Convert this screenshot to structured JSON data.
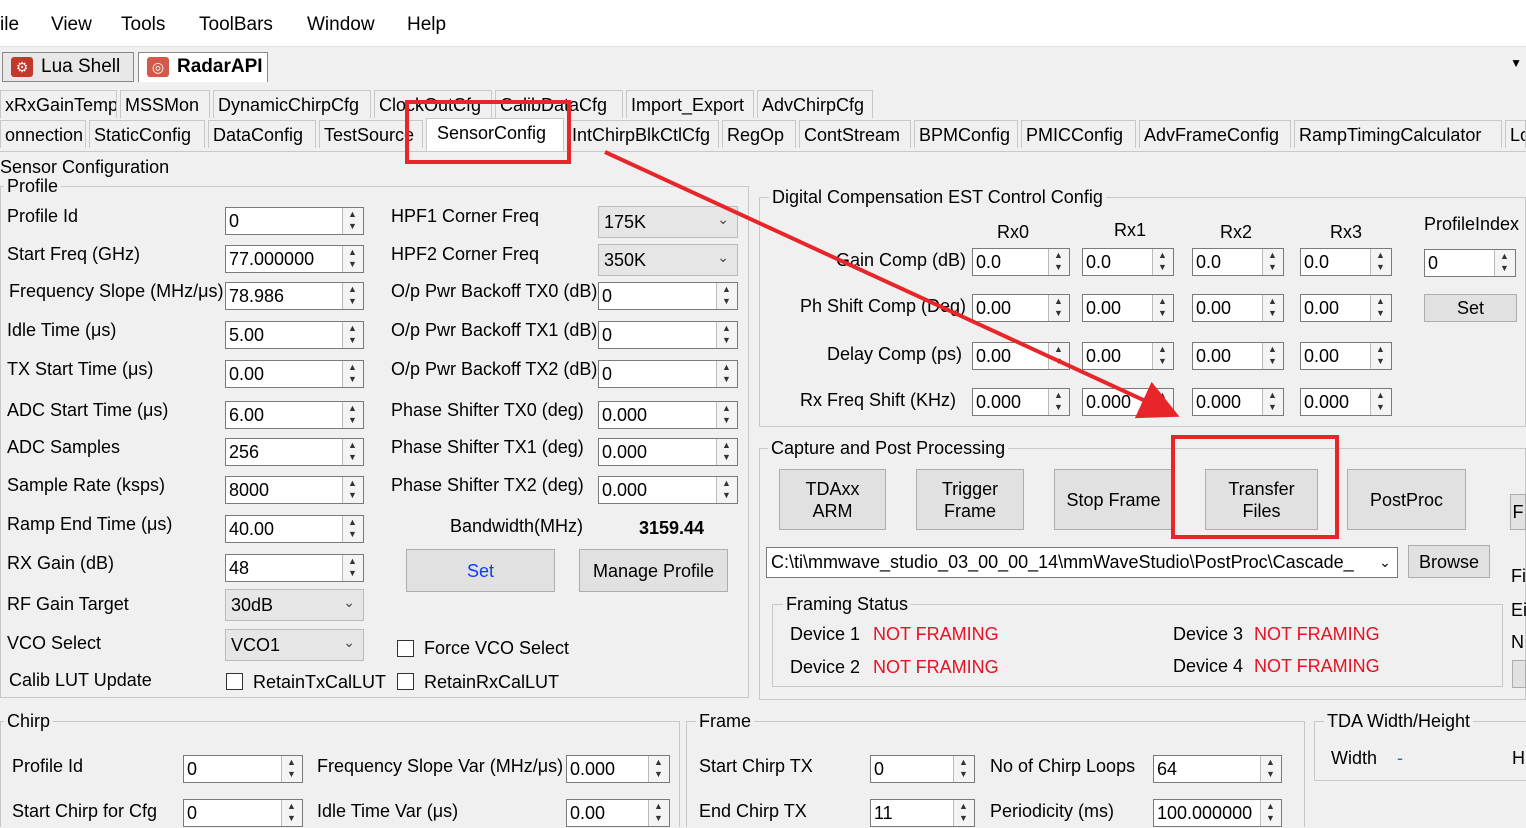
{
  "menu": [
    "ile",
    "View",
    "Tools",
    "ToolBars",
    "Window",
    "Help"
  ],
  "shell_tabs": [
    "Lua Shell",
    "RadarAPI"
  ],
  "tabs_row1": [
    "xRxGainTemp",
    "MSSMon",
    "DynamicChirpCfg",
    "ClockOutCfg",
    "CalibDataCfg",
    "Import_Export",
    "AdvChirpCfg"
  ],
  "tabs_row2": [
    "onnection",
    "StaticConfig",
    "DataConfig",
    "TestSource",
    "SensorConfig",
    "IntChirpBlkCtlCfg",
    "RegOp",
    "ContStream",
    "BPMConfig",
    "PMICConfig",
    "AdvFrameConfig",
    "RampTimingCalculator",
    "Lo"
  ],
  "sensor": {
    "title": "Sensor Configuration",
    "profile_title": "Profile",
    "profile": [
      {
        "label": "Profile Id",
        "value": "0"
      },
      {
        "label": "Start Freq (GHz)",
        "value": "77.000000"
      },
      {
        "label": "Frequency Slope (MHz/μs)",
        "value": "78.986"
      },
      {
        "label": "Idle Time (μs)",
        "value": "5.00"
      },
      {
        "label": "TX Start Time (μs)",
        "value": "0.00"
      },
      {
        "label": "ADC Start Time (μs)",
        "value": "6.00"
      },
      {
        "label": "ADC Samples",
        "value": "256"
      },
      {
        "label": "Sample Rate (ksps)",
        "value": "8000"
      },
      {
        "label": "Ramp End Time (μs)",
        "value": "40.00"
      },
      {
        "label": "RX Gain (dB)",
        "value": "48"
      }
    ],
    "rf_gain_label": "RF Gain Target",
    "rf_gain_value": "30dB",
    "vco_label": "VCO Select",
    "vco_value": "VCO1",
    "force_vco": "Force VCO Select",
    "calib_lut_label": "Calib LUT Update",
    "retain_tx": "RetainTxCalLUT",
    "retain_rx": "RetainRxCalLUT",
    "hpf1_label": "HPF1 Corner Freq",
    "hpf1_value": "175K",
    "hpf2_label": "HPF2 Corner Freq",
    "hpf2_value": "350K",
    "right_fields": [
      {
        "label": "O/p Pwr Backoff TX0 (dB)",
        "value": "0"
      },
      {
        "label": "O/p Pwr Backoff TX1 (dB)",
        "value": "0"
      },
      {
        "label": "O/p Pwr Backoff TX2 (dB)",
        "value": "0"
      },
      {
        "label": "Phase Shifter TX0 (deg)",
        "value": "0.000"
      },
      {
        "label": "Phase Shifter TX1 (deg)",
        "value": "0.000"
      },
      {
        "label": "Phase Shifter TX2 (deg)",
        "value": "0.000"
      }
    ],
    "bandwidth_label": "Bandwidth(MHz)",
    "bandwidth_value": "3159.44",
    "set_label": "Set",
    "manage_profile": "Manage Profile"
  },
  "digital": {
    "title": "Digital Compensation EST Control Config",
    "cols": [
      "Rx0",
      "Rx1",
      "Rx2",
      "Rx3"
    ],
    "profile_index_label": "ProfileIndex",
    "profile_index_value": "0",
    "set_label": "Set",
    "rows": [
      {
        "label": "Gain Comp (dB)",
        "values": [
          "0.0",
          "0.0",
          "0.0",
          "0.0"
        ]
      },
      {
        "label": "Ph Shift Comp (Deg)",
        "values": [
          "0.00",
          "0.00",
          "0.00",
          "0.00"
        ]
      },
      {
        "label": "Delay Comp (ps)",
        "values": [
          "0.00",
          "0.00",
          "0.00",
          "0.00"
        ]
      },
      {
        "label": "Rx Freq Shift (KHz)",
        "values": [
          "0.000",
          "0.000",
          "0.000",
          "0.000"
        ]
      }
    ]
  },
  "capture": {
    "title": "Capture and Post Processing",
    "tda_arm_1": "TDAxx",
    "tda_arm_2": "ARM",
    "trigger_1": "Trigger",
    "trigger_2": "Frame",
    "stop_frame": "Stop Frame",
    "transfer_1": "Transfer",
    "transfer_2": "Files",
    "postproc": "PostProc",
    "edge_btn": "F",
    "path": "C:\\ti\\mmwave_studio_03_00_00_14\\mmWaveStudio\\PostProc\\Cascade_",
    "browse": "Browse",
    "edge_labels": [
      "Fi",
      "Ei",
      "N"
    ]
  },
  "framing": {
    "title": "Framing Status",
    "devices": [
      {
        "name": "Device 1",
        "status": "NOT FRAMING"
      },
      {
        "name": "Device 2",
        "status": "NOT FRAMING"
      },
      {
        "name": "Device 3",
        "status": "NOT FRAMING"
      },
      {
        "name": "Device 4",
        "status": "NOT FRAMING"
      }
    ]
  },
  "chirp": {
    "title": "Chirp",
    "profile_id_label": "Profile Id",
    "profile_id_value": "0",
    "start_chirp_label": "Start Chirp for Cfg",
    "start_chirp_value": "0",
    "freq_slope_var_label": "Frequency Slope Var (MHz/μs)",
    "freq_slope_var_value": "0.000",
    "idle_time_var_label": "Idle Time Var (μs)",
    "idle_time_var_value": "0.00"
  },
  "frame": {
    "title": "Frame",
    "start_chirp_tx_label": "Start Chirp TX",
    "start_chirp_tx_value": "0",
    "end_chirp_tx_label": "End Chirp TX",
    "end_chirp_tx_value": "11",
    "loops_label": "No of Chirp Loops",
    "loops_value": "64",
    "periodicity_label": "Periodicity (ms)",
    "periodicity_value": "100.000000"
  },
  "tda": {
    "title": "TDA Width/Height",
    "width_label": "Width",
    "width_value": "-",
    "h_label": "H"
  },
  "colors": {
    "highlight": "#e8262a",
    "status_red": "#e81123"
  }
}
